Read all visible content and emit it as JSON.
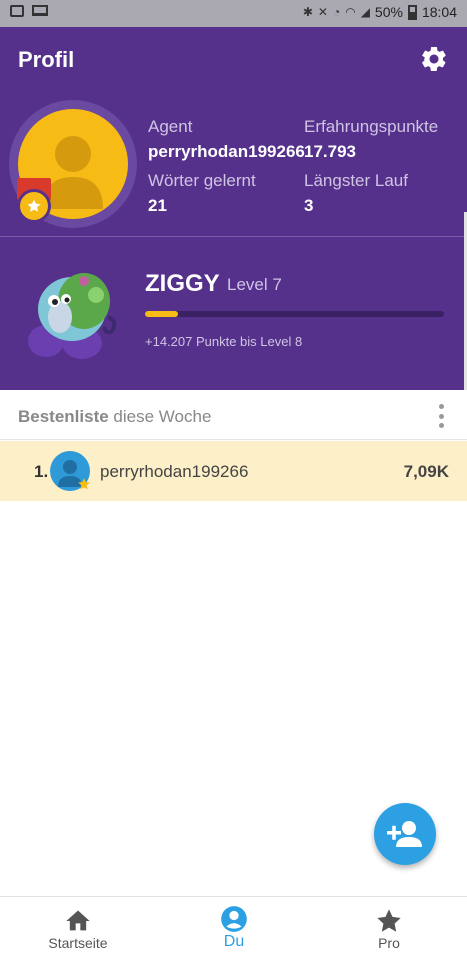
{
  "status_bar": {
    "battery": "50%",
    "time": "18:04"
  },
  "app_bar": {
    "title": "Profil",
    "settings_icon": "gear-icon"
  },
  "profile": {
    "stats": [
      {
        "label": "Agent",
        "value": "perryrhodan199266"
      },
      {
        "label": "Erfahrungspunkte",
        "value": "17.793"
      },
      {
        "label": "Wörter gelernt",
        "value": "21"
      },
      {
        "label": "Längster Lauf",
        "value": "3"
      }
    ]
  },
  "level": {
    "name": "ZIGGY",
    "level_text": "Level 7",
    "progress_fraction": 0.11,
    "points_text": "+14.207 Punkte bis Level 8"
  },
  "leaderboard": {
    "title_bold": "Bestenliste",
    "title_rest": " diese Woche",
    "rows": [
      {
        "rank": "1.",
        "username": "perryrhodan199266",
        "score": "7,09K"
      }
    ]
  },
  "fab": {
    "icon": "add-person-icon"
  },
  "bottom_nav": {
    "items": [
      {
        "label": "Startseite",
        "icon": "home-icon"
      },
      {
        "label": "Du",
        "icon": "account-icon"
      },
      {
        "label": "Pro",
        "icon": "star-icon"
      }
    ],
    "active": "Du"
  },
  "colors": {
    "purple": "#55318c",
    "yellow": "#f7bb16",
    "blue": "#2ca0e3"
  }
}
